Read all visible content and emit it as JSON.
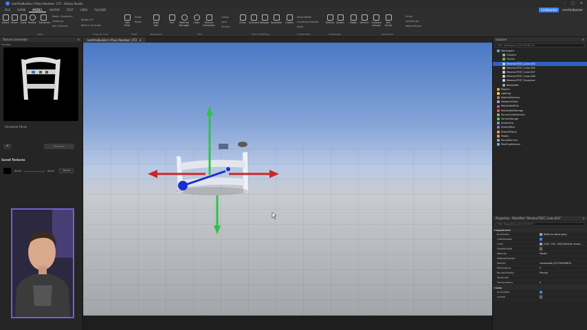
{
  "titlebar": {
    "text": "lamfrheBuilder's Place Number: 272 - Roblox Studio",
    "min": "–",
    "max": "□",
    "close": "✕"
  },
  "menubar": {
    "tabs": [
      "FILE",
      "HOME",
      "MODEL",
      "AVATAR",
      "TEST",
      "VIEW",
      "PLUGINS"
    ],
    "active_index": 2,
    "collaborate": "Collaborate",
    "user": "lamfrheBuilder"
  },
  "ribbon": {
    "tools": [
      "Select",
      "Move",
      "Scale",
      "Rotate",
      "Transform"
    ],
    "move_options": [
      "Mode: Geometric",
      "Collisions",
      "Join Surfaces"
    ],
    "snap_options": [
      "Rotate 15°",
      "Move 0.25 studs"
    ],
    "pivot": {
      "edit": "Edit Pivot",
      "show": "Show",
      "reset": "Reset"
    },
    "align": "Align Tool",
    "parts": [
      "Part",
      "Material Manager",
      "Color",
      "Texture Generator"
    ],
    "group_opts": [
      "Group",
      "Lock",
      "Anchor"
    ],
    "solid": [
      "Union",
      "Intersect",
      "Negate",
      "Separate"
    ],
    "constraints": {
      "create": "Create",
      "show_welds": "Show Welds",
      "details": "Constraint Details",
      "scale": "Scale"
    },
    "gameplay": [
      "Effects",
      "Spawn"
    ],
    "advanced": [
      "Model",
      "Service",
      "Collision Groups",
      "Run Script"
    ],
    "scripts": [
      "Script",
      "LocalScript",
      "ModuleScript"
    ],
    "groups": [
      "Tools",
      "Snap to Grid",
      "Pivot",
      "Alignment",
      "Part",
      "Solid Modeling",
      "Constraints",
      "Gameplay",
      "Advanced"
    ]
  },
  "left_panel": {
    "title": "Texture Generator",
    "preview_label": "Preview",
    "asset_name": "Unnamed Fence",
    "generate_button": "Generate",
    "saved_title": "Saved Textures",
    "clip": {
      "start": "00:03",
      "end": "00:07",
      "button": "Cancel"
    }
  },
  "viewport_tab": "lamfrheBuilder's Place Number: 272",
  "explorer": {
    "title": "Explorer",
    "filter_placeholder": "Filter workspace (Ctrl+Shift+X)",
    "items": [
      {
        "label": "Workspace",
        "depth": 0,
        "color": "#5aa0ff",
        "selected": false
      },
      {
        "label": "Camera",
        "depth": 1,
        "color": "#9aa6b2",
        "selected": false
      },
      {
        "label": "Terrain",
        "depth": 1,
        "color": "#6bbf59",
        "selected": false
      },
      {
        "label": "Meshes/TEST_Cube.003",
        "depth": 1,
        "color": "#cfcfcf",
        "selected": true
      },
      {
        "label": "Meshes/TEST_Cube.006",
        "depth": 1,
        "color": "#cfcfcf",
        "selected": false
      },
      {
        "label": "Meshes/TEST_Cube.007",
        "depth": 1,
        "color": "#cfcfcf",
        "selected": false
      },
      {
        "label": "Meshes/TEST_Cube.008",
        "depth": 1,
        "color": "#cfcfcf",
        "selected": false
      },
      {
        "label": "Meshes/TEST_Sculpture",
        "depth": 1,
        "color": "#cfcfcf",
        "selected": false
      },
      {
        "label": "Baseplate",
        "depth": 1,
        "color": "#8aa4c8",
        "selected": false
      },
      {
        "label": "Players",
        "depth": 0,
        "color": "#e0a040",
        "selected": false
      },
      {
        "label": "Lighting",
        "depth": 0,
        "color": "#f0d050",
        "selected": false
      },
      {
        "label": "MaterialService",
        "depth": 0,
        "color": "#c07850",
        "selected": false
      },
      {
        "label": "NetworkClient",
        "depth": 0,
        "color": "#70b0e0",
        "selected": false
      },
      {
        "label": "ReplicatedFirst",
        "depth": 0,
        "color": "#e05050",
        "selected": false
      },
      {
        "label": "ReplicatedStorage",
        "depth": 0,
        "color": "#e05050",
        "selected": false
      },
      {
        "label": "ServerScriptService",
        "depth": 0,
        "color": "#60c060",
        "selected": false
      },
      {
        "label": "ServerStorage",
        "depth": 0,
        "color": "#60c060",
        "selected": false
      },
      {
        "label": "StarterGui",
        "depth": 0,
        "color": "#60a0e0",
        "selected": false
      },
      {
        "label": "StarterPack",
        "depth": 0,
        "color": "#a070d0",
        "selected": false
      },
      {
        "label": "StarterPlayer",
        "depth": 0,
        "color": "#e0a040",
        "selected": false
      },
      {
        "label": "Teams",
        "depth": 0,
        "color": "#e0a040",
        "selected": false
      },
      {
        "label": "SoundService",
        "depth": 0,
        "color": "#60b0e0",
        "selected": false
      },
      {
        "label": "TextChatService",
        "depth": 0,
        "color": "#60b0e0",
        "selected": false
      }
    ]
  },
  "properties": {
    "title": "Properties - MeshPart \"Meshes/TEST_Cube.003\"",
    "filter_placeholder": "Filter Properties (Ctrl+Shift+P)",
    "section_appearance": "Appearance",
    "rows": [
      {
        "key": "BrickColor",
        "value": "Medium stone grey",
        "type": "swatch",
        "swatch": "#a3a2a5"
      },
      {
        "key": "CastShadow",
        "value": "",
        "type": "check",
        "on": true
      },
      {
        "key": "Color",
        "value": "[163, 162, 165] Medium stone...",
        "type": "swatch",
        "swatch": "#a3a2a5"
      },
      {
        "key": "DoubleSided",
        "value": "",
        "type": "check",
        "on": false
      },
      {
        "key": "Material",
        "value": "Plastic",
        "type": "text"
      },
      {
        "key": "MaterialVariant",
        "value": "",
        "type": "text"
      },
      {
        "key": "MeshId",
        "value": "rbxassetid://13700038874",
        "type": "text"
      },
      {
        "key": "Reflectance",
        "value": "0",
        "type": "text"
      },
      {
        "key": "RenderFidelity",
        "value": "Precise",
        "type": "text"
      },
      {
        "key": "TextureID",
        "value": "",
        "type": "text"
      },
      {
        "key": "Transparency",
        "value": "0",
        "type": "text"
      }
    ],
    "section_data": "Data",
    "data_rows": [
      {
        "key": "Archivable",
        "on": true
      },
      {
        "key": "Locked",
        "on": false
      }
    ]
  }
}
